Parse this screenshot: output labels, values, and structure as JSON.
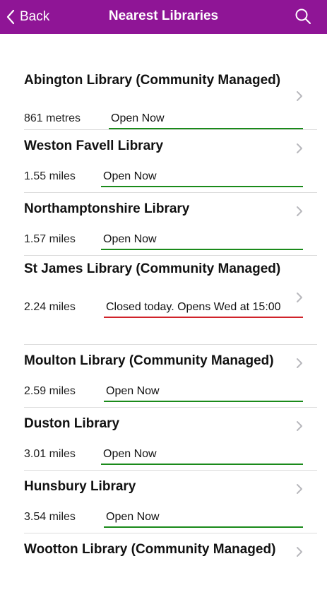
{
  "header": {
    "back_label": "Back",
    "title": "Nearest Libraries",
    "background_color": "#8f1596"
  },
  "colors": {
    "open": "#1a8a1a",
    "closed": "#d0232a"
  },
  "libraries": [
    {
      "name": "Abington Library (Community Managed)",
      "distance": "861 metres",
      "status": "Open Now",
      "is_open": true
    },
    {
      "name": "Weston Favell Library",
      "distance": "1.55 miles",
      "status": "Open Now",
      "is_open": true
    },
    {
      "name": "Northamptonshire Library",
      "distance": "1.57 miles",
      "status": "Open Now",
      "is_open": true
    },
    {
      "name": "St James Library (Community Managed)",
      "distance": "2.24 miles",
      "status": "Closed today. Opens Wed at 15:00",
      "is_open": false
    },
    {
      "name": "Moulton Library (Community Managed)",
      "distance": "2.59 miles",
      "status": "Open Now",
      "is_open": true
    },
    {
      "name": "Duston Library",
      "distance": "3.01 miles",
      "status": "Open Now",
      "is_open": true
    },
    {
      "name": "Hunsbury Library",
      "distance": "3.54 miles",
      "status": "Open Now",
      "is_open": true
    },
    {
      "name": "Wootton Library (Community Managed)",
      "distance": "",
      "status": "",
      "is_open": true
    }
  ]
}
